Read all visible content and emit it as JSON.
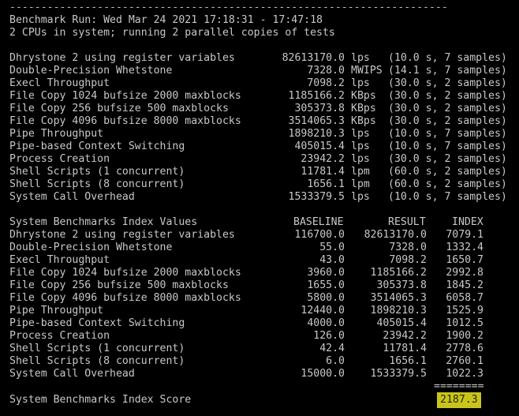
{
  "separator": "----------------------------------------------------------------------",
  "header": {
    "run": "Benchmark Run: Wed Mar 24 2021 17:18:31 - 17:47:18",
    "cpus": "2 CPUs in system; running 2 parallel copies of tests"
  },
  "results": [
    {
      "name": "Dhrystone 2 using register variables",
      "value": "82613170.0",
      "unit": "lps",
      "meta": "(10.0 s, 7 samples)"
    },
    {
      "name": "Double-Precision Whetstone",
      "value": "7328.0",
      "unit": "MWIPS",
      "meta": "(14.1 s, 7 samples)"
    },
    {
      "name": "Execl Throughput",
      "value": "7098.2",
      "unit": "lps",
      "meta": "(30.0 s, 2 samples)"
    },
    {
      "name": "File Copy 1024 bufsize 2000 maxblocks",
      "value": "1185166.2",
      "unit": "KBps",
      "meta": "(30.0 s, 2 samples)"
    },
    {
      "name": "File Copy 256 bufsize 500 maxblocks",
      "value": "305373.8",
      "unit": "KBps",
      "meta": "(30.0 s, 2 samples)"
    },
    {
      "name": "File Copy 4096 bufsize 8000 maxblocks",
      "value": "3514065.3",
      "unit": "KBps",
      "meta": "(30.0 s, 2 samples)"
    },
    {
      "name": "Pipe Throughput",
      "value": "1898210.3",
      "unit": "lps",
      "meta": "(10.0 s, 7 samples)"
    },
    {
      "name": "Pipe-based Context Switching",
      "value": "405015.4",
      "unit": "lps",
      "meta": "(10.0 s, 7 samples)"
    },
    {
      "name": "Process Creation",
      "value": "23942.2",
      "unit": "lps",
      "meta": "(30.0 s, 2 samples)"
    },
    {
      "name": "Shell Scripts (1 concurrent)",
      "value": "11781.4",
      "unit": "lpm",
      "meta": "(60.0 s, 2 samples)"
    },
    {
      "name": "Shell Scripts (8 concurrent)",
      "value": "1656.1",
      "unit": "lpm",
      "meta": "(60.0 s, 2 samples)"
    },
    {
      "name": "System Call Overhead",
      "value": "1533379.5",
      "unit": "lps",
      "meta": "(10.0 s, 7 samples)"
    }
  ],
  "index_table": {
    "title": "System Benchmarks Index Values",
    "col_baseline": "BASELINE",
    "col_result": "RESULT",
    "col_index": "INDEX",
    "rows": [
      {
        "name": "Dhrystone 2 using register variables",
        "baseline": "116700.0",
        "result": "82613170.0",
        "index": "7079.1"
      },
      {
        "name": "Double-Precision Whetstone",
        "baseline": "55.0",
        "result": "7328.0",
        "index": "1332.4"
      },
      {
        "name": "Execl Throughput",
        "baseline": "43.0",
        "result": "7098.2",
        "index": "1650.7"
      },
      {
        "name": "File Copy 1024 bufsize 2000 maxblocks",
        "baseline": "3960.0",
        "result": "1185166.2",
        "index": "2992.8"
      },
      {
        "name": "File Copy 256 bufsize 500 maxblocks",
        "baseline": "1655.0",
        "result": "305373.8",
        "index": "1845.2"
      },
      {
        "name": "File Copy 4096 bufsize 8000 maxblocks",
        "baseline": "5800.0",
        "result": "3514065.3",
        "index": "6058.7"
      },
      {
        "name": "Pipe Throughput",
        "baseline": "12440.0",
        "result": "1898210.3",
        "index": "1525.9"
      },
      {
        "name": "Pipe-based Context Switching",
        "baseline": "4000.0",
        "result": "405015.4",
        "index": "1012.5"
      },
      {
        "name": "Process Creation",
        "baseline": "126.0",
        "result": "23942.2",
        "index": "1900.2"
      },
      {
        "name": "Shell Scripts (1 concurrent)",
        "baseline": "42.4",
        "result": "11781.4",
        "index": "2778.6"
      },
      {
        "name": "Shell Scripts (8 concurrent)",
        "baseline": "6.0",
        "result": "1656.1",
        "index": "2760.1"
      },
      {
        "name": "System Call Overhead",
        "baseline": "15000.0",
        "result": "1533379.5",
        "index": "1022.3"
      }
    ],
    "rule": "========",
    "score_label": "System Benchmarks Index Score",
    "score": "2187.3"
  },
  "colors": {
    "background": "#000000",
    "text": "#c8c8c8",
    "highlight": "#c9c41c"
  }
}
